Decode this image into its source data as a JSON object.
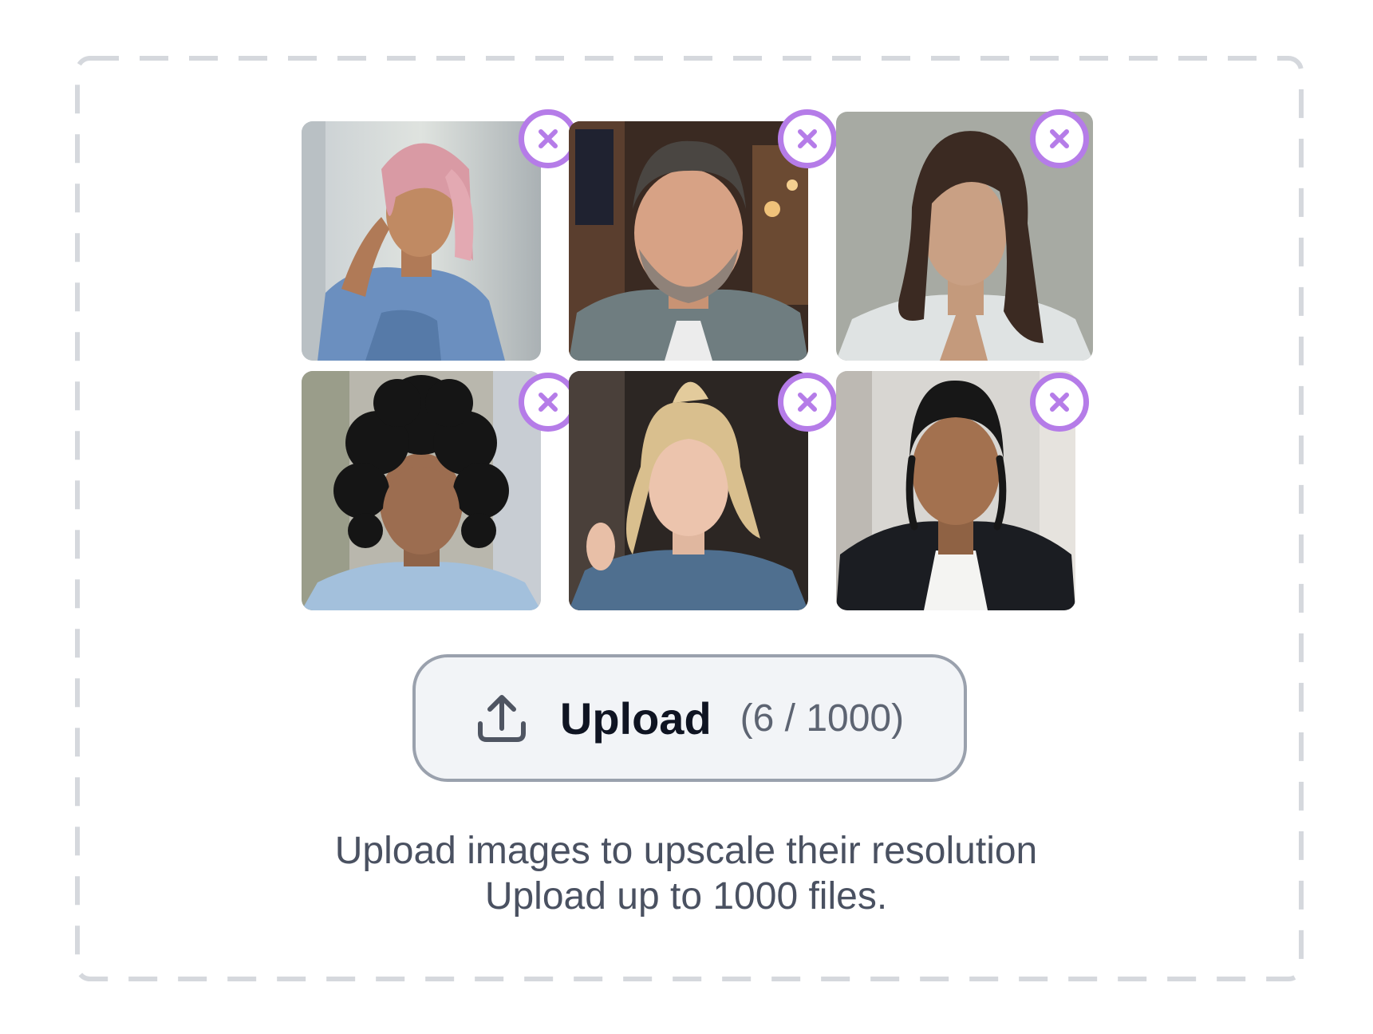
{
  "upload": {
    "button_label": "Upload",
    "count_text": "(6 / 1000)",
    "upload_icon": "upload-arrow-icon"
  },
  "helper": {
    "line1": "Upload images to upscale their resolution",
    "line2": "Upload up to 1000 files."
  },
  "thumbnails": [
    {
      "subject": "woman with pink bob hair in denim jacket",
      "remove_icon": "close-icon"
    },
    {
      "subject": "middle-aged man with grey hair and beard",
      "remove_icon": "close-icon"
    },
    {
      "subject": "woman with long dark hair",
      "remove_icon": "close-icon"
    },
    {
      "subject": "woman with curly black hair",
      "remove_icon": "close-icon"
    },
    {
      "subject": "young woman with blonde ponytail",
      "remove_icon": "close-icon"
    },
    {
      "subject": "young man with braided hair in black coat",
      "remove_icon": "close-icon"
    }
  ],
  "colors": {
    "accent_remove": "#b57ce8",
    "dash_border": "#d5d8dd",
    "button_bg": "#f2f4f7",
    "button_border": "#9aa1ad"
  }
}
